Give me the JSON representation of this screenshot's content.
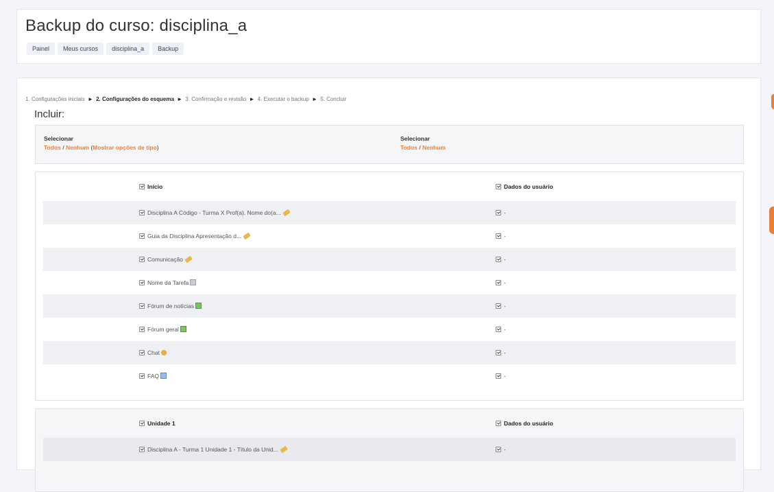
{
  "header": {
    "title": "Backup do curso: disciplina_a",
    "breadcrumb": [
      "Painel",
      "Meus cursos",
      "disciplina_a",
      "Backup"
    ]
  },
  "steps": {
    "s1": "1. Configurações iniciais",
    "s2": "2. Configurações do esquema",
    "s3": "3. Confirmação e revisão",
    "s4": "4. Executar o backup",
    "s5": "5. Concluir",
    "arrow": "►"
  },
  "include_heading": "Incluir:",
  "select_panel": {
    "left": {
      "label": "Selecionar",
      "all": "Todos",
      "sep": " / ",
      "none": "Nenhum",
      "open": " (",
      "show_types": "Mostrar opções de tipo",
      "close": ")"
    },
    "right": {
      "label": "Selecionar",
      "all": "Todos",
      "sep": " / ",
      "none": "Nenhum"
    }
  },
  "sections": [
    {
      "title": "Início",
      "userdata_label": "Dados do usuário",
      "items": [
        {
          "label": "Disciplina A Código - Turma X Prof(a). Nome do(a...",
          "icon": "label-icon",
          "userdata": "-"
        },
        {
          "label": "Guia da Disciplina Apresentação d...",
          "icon": "label-icon",
          "userdata": "-"
        },
        {
          "label": "Comunicação",
          "icon": "label-icon",
          "userdata": "-"
        },
        {
          "label": "Nome da Tarefa",
          "icon": "assignment-icon",
          "userdata": "-"
        },
        {
          "label": "Fórum de notícias",
          "icon": "forum-icon",
          "userdata": "-"
        },
        {
          "label": "Fórum geral",
          "icon": "forum-icon",
          "userdata": "-"
        },
        {
          "label": "Chat",
          "icon": "chat-icon",
          "userdata": "-"
        },
        {
          "label": "FAQ",
          "icon": "glossary-icon",
          "userdata": "-"
        }
      ]
    },
    {
      "title": "Unidade 1",
      "userdata_label": "Dados do usuário",
      "items": [
        {
          "label": "Disciplina A - Turma 1 Unidade 1 - Título da Unid...",
          "icon": "label-icon",
          "userdata": "-"
        }
      ]
    }
  ],
  "colors": {
    "accent": "#ef7e35"
  }
}
